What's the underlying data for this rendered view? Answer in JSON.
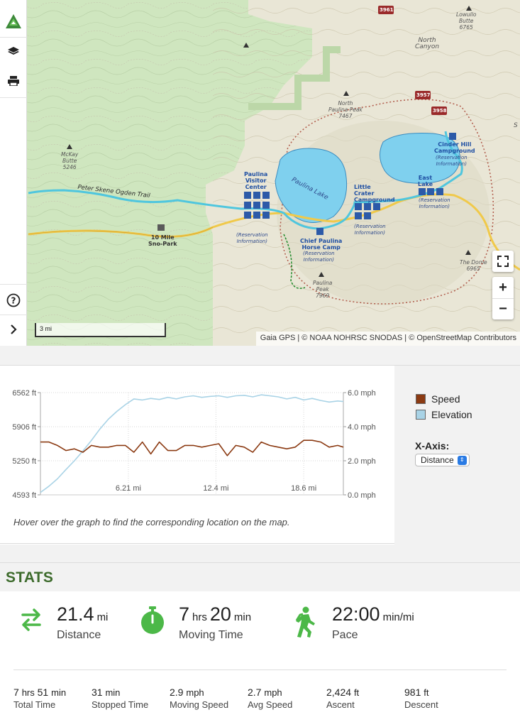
{
  "map": {
    "labels": {
      "lowullo_butte": "Lowullo\nButte\n6765",
      "north_canyon": "North\nCanyon",
      "north_paulina_peak": "North\nPaulina Peak\n7467",
      "mckay_butte": "McKay\nButte\n5246",
      "paulina_visitor_center": "Paulina\nVisitor\nCenter",
      "paulina_lake": "Paulina Lake",
      "cinder_hill_campground": "Cinder Hill\nCampground",
      "cinder_hill_reservation": "(Reservation\nInformation)",
      "east_lake": "East\nLake",
      "east_lake_reservation": "(Reservation\nInformation)",
      "little_crater_campground": "Little\nCrater\nCampground",
      "little_crater_reservation": "(Reservation\nInformation)",
      "visitor_reservation": "(Reservation\nInformation)",
      "ten_mile_sno_park": "10 Mile\nSno-Park",
      "chief_paulina_horse_camp": "Chief Paulina\nHorse Camp",
      "chief_paulina_reservation": "(Reservation\nInformation)",
      "paulina_peak": "Paulina\nPeak\n7969",
      "the_dome": "The Dome\n6965",
      "trail_name": "Peter Skene Ogden Trail",
      "partial_label": "S"
    },
    "route_badges": [
      "3961",
      "3957",
      "3958"
    ],
    "scale_text": "3 mi",
    "attribution": "Gaia GPS | © NOAA NOHRSC SNODAS | © OpenStreetMap Contributors",
    "controls": {
      "zoom_in": "+",
      "zoom_out": "−",
      "fullscreen_icon": "expand-icon"
    },
    "toolbar_icons": [
      "gaia-logo-icon",
      "layers-icon",
      "print-icon",
      "help-icon",
      "chevron-right-icon"
    ]
  },
  "chart": {
    "hint": "Hover over the graph to find the corresponding location on the map.",
    "legend": [
      {
        "name": "Speed",
        "color": "#8b3a12"
      },
      {
        "name": "Elevation",
        "color": "#a9d3e6"
      }
    ],
    "xaxis_label": "X-Axis:",
    "xaxis_value": "Distance"
  },
  "chart_data": {
    "type": "line",
    "x_unit": "mi",
    "x_ticks": [
      6.21,
      12.4,
      18.6
    ],
    "x_tick_labels": [
      "6.21 mi",
      "12.4 mi",
      "18.6 mi"
    ],
    "xlim": [
      0,
      21.4
    ],
    "y_left_label_ticks": [
      "4593 ft",
      "5250 ft",
      "5906 ft",
      "6562 ft"
    ],
    "y_left_ticks": [
      4593,
      5250,
      5906,
      6562
    ],
    "ylim_left": [
      4593,
      6562
    ],
    "y_right_label_ticks": [
      "0.0 mph",
      "2.0 mph",
      "4.0 mph",
      "6.0 mph"
    ],
    "y_right_ticks": [
      0,
      2,
      4,
      6
    ],
    "ylim_right": [
      0,
      6
    ],
    "grid": true,
    "series": [
      {
        "name": "Elevation",
        "axis": "left",
        "color": "#a9d3e6",
        "x": [
          0,
          0.6,
          1.2,
          1.8,
          2.4,
          3.0,
          3.6,
          4.2,
          4.8,
          5.4,
          6.0,
          6.6,
          7.2,
          7.8,
          8.4,
          9.0,
          9.6,
          10.2,
          10.8,
          11.4,
          12.0,
          12.6,
          13.2,
          13.8,
          14.4,
          15.0,
          15.6,
          16.2,
          16.8,
          17.4,
          18.0,
          18.6,
          19.2,
          19.8,
          20.4,
          21.0,
          21.4
        ],
        "values": [
          4640,
          4760,
          4900,
          5080,
          5250,
          5440,
          5640,
          5860,
          6050,
          6200,
          6330,
          6440,
          6420,
          6450,
          6430,
          6470,
          6440,
          6480,
          6500,
          6470,
          6490,
          6500,
          6470,
          6500,
          6510,
          6480,
          6520,
          6500,
          6480,
          6440,
          6470,
          6420,
          6450,
          6410,
          6380,
          6400,
          6390
        ]
      },
      {
        "name": "Speed",
        "axis": "right",
        "color": "#8b3a12",
        "x": [
          0,
          0.6,
          1.2,
          1.8,
          2.4,
          3.0,
          3.6,
          4.2,
          4.8,
          5.4,
          6.0,
          6.6,
          7.2,
          7.8,
          8.4,
          9.0,
          9.6,
          10.2,
          10.8,
          11.4,
          12.0,
          12.6,
          13.2,
          13.8,
          14.4,
          15.0,
          15.6,
          16.2,
          16.8,
          17.4,
          18.0,
          18.6,
          19.2,
          19.8,
          20.4,
          21.0,
          21.4
        ],
        "values": [
          3.1,
          3.1,
          2.9,
          2.6,
          2.7,
          2.5,
          2.9,
          2.8,
          2.8,
          2.9,
          2.9,
          2.5,
          3.1,
          2.4,
          3.1,
          2.6,
          2.6,
          2.9,
          2.9,
          2.8,
          2.9,
          3.0,
          2.3,
          2.9,
          2.8,
          2.5,
          3.1,
          2.9,
          2.8,
          2.7,
          2.8,
          3.2,
          3.2,
          3.1,
          2.8,
          2.9,
          2.8
        ]
      }
    ]
  },
  "stats": {
    "title": "STATS",
    "big": [
      {
        "value": "21.4",
        "unit": "mi",
        "label": "Distance",
        "icon": "swap-arrows-icon"
      },
      {
        "value_a": "7",
        "unit_a": "hrs",
        "value_b": "20",
        "unit_b": "min",
        "label": "Moving Time",
        "icon": "stopwatch-icon"
      },
      {
        "value": "22:00",
        "unit": "min/mi",
        "label": "Pace",
        "icon": "hiker-icon"
      }
    ],
    "small": [
      {
        "v1": "7",
        "u1": "hrs",
        "v2": "51",
        "u2": "min",
        "label": "Total Time"
      },
      {
        "v1": "31",
        "u1": "min",
        "label": "Stopped Time"
      },
      {
        "v1": "2.9",
        "u1": "mph",
        "label": "Moving Speed"
      },
      {
        "v1": "2.7",
        "u1": "mph",
        "label": "Avg Speed"
      },
      {
        "v1": "2,424",
        "u1": "ft",
        "label": "Ascent"
      },
      {
        "v1": "981",
        "u1": "ft",
        "label": "Descent"
      }
    ],
    "accent_color": "#4cb848"
  }
}
